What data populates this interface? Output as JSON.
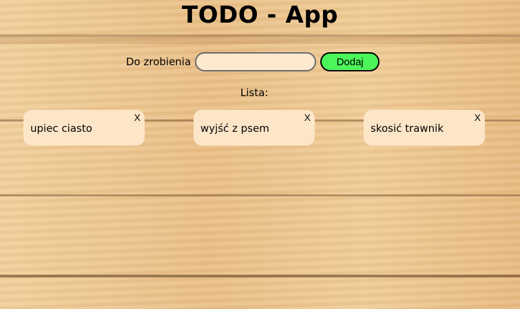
{
  "app": {
    "title": "TODO - App"
  },
  "form": {
    "label": "Do zrobienia",
    "input_value": "",
    "button_label": "Dodaj",
    "button_color": "#4cf55a"
  },
  "list": {
    "label": "Lista:",
    "items": [
      {
        "text": "upiec ciasto",
        "close": "X"
      },
      {
        "text": "wyjść z psem",
        "close": "X"
      },
      {
        "text": "skosić trawnik",
        "close": "X"
      }
    ]
  }
}
